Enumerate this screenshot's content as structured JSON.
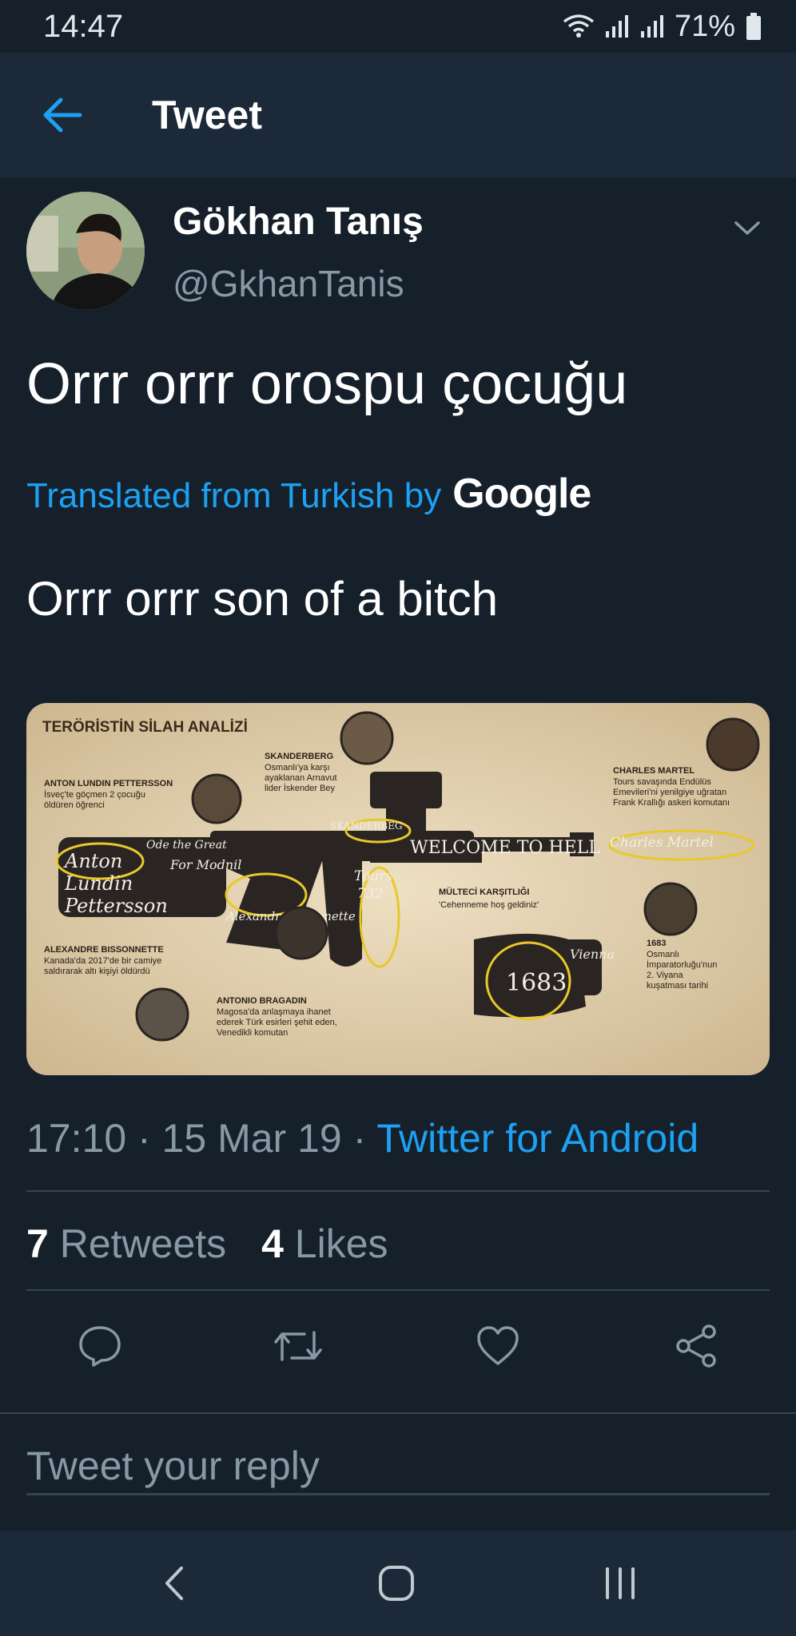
{
  "status_bar": {
    "time": "14:47",
    "battery": "71%",
    "icons": [
      "wifi-icon",
      "signal-icon",
      "signal-icon",
      "battery-icon"
    ]
  },
  "app_bar": {
    "title": "Tweet",
    "back_icon": "arrow-left-icon"
  },
  "tweet": {
    "author_name": "Gökhan Tanış",
    "author_handle": "@GkhanTanis",
    "text": "Orrr orrr orospu çocuğu",
    "translated_label": "Translated from Turkish by",
    "translator": "Google",
    "translated_text": "Orrr orrr son of a bitch",
    "timestamp": "17:10 · 15 Mar 19 · ",
    "source": "Twitter for Android"
  },
  "media": {
    "heading": "TERÖRİSTİN SİLAH ANALİZİ",
    "labels": [
      {
        "title": "ANTON LUNDIN PETTERSSON",
        "lines": [
          "İsveç'te göçmen 2 çocuğu",
          "öldüren öğrenci"
        ]
      },
      {
        "title": "SKANDERBERG",
        "lines": [
          "Osmanlı'ya karşı",
          "ayaklanan Arnavut",
          "lider İskender Bey"
        ]
      },
      {
        "title": "CHARLES MARTEL",
        "lines": [
          "Tours savaşında Endülüs",
          "Emevileri'ni yenilgiye uğratan",
          "Frank Krallığı askeri komutanı"
        ]
      },
      {
        "title": "MÜLTECİ KARŞITLIĞI",
        "lines": [
          "'Cehenneme hoş geldiniz'"
        ]
      },
      {
        "title": "ALEXANDRE BISSONNETTE",
        "lines": [
          "Kanada'da 2017'de bir camiye",
          "saldırarak altı kişiyi öldürdü"
        ]
      },
      {
        "title": "ANTONIO BRAGADIN",
        "lines": [
          "Magosa'da anlaşmaya ihanet",
          "ederek Türk esirleri şehit eden,",
          "Venedikli komutan"
        ]
      },
      {
        "title": "1683",
        "lines": [
          "Osmanlı",
          "İmparatorluğu'nun",
          "2. Viyana",
          "kuşatması tarihi"
        ]
      }
    ],
    "gun_text": {
      "anton": "Anton",
      "lundin": "Lundin",
      "pettersson": "Pettersson",
      "welcome": "WELCOME TO HELL",
      "charles": "Charles Martel",
      "tours": "Tours",
      "year732": "732",
      "year1683": "1683",
      "vienna": "Vienna",
      "skanderbeg": "SKANDERBEG",
      "ode": "Ode the Great",
      "for_modnil": "For Modnil",
      "alexandre": "Alexandre Bissonette"
    }
  },
  "stats": {
    "retweets_count": "7",
    "retweets_label": "Retweets",
    "likes_count": "4",
    "likes_label": "Likes"
  },
  "actions": [
    "reply-icon",
    "retweet-icon",
    "like-icon",
    "share-icon"
  ],
  "reply": {
    "placeholder": "Tweet your reply"
  },
  "nav": [
    "back-nav-icon",
    "home-nav-icon",
    "recents-nav-icon"
  ],
  "colors": {
    "background": "#15202b",
    "bar": "#1c2938",
    "accent": "#1da1f2",
    "secondary_text": "#8899a6",
    "divider": "#38444d"
  }
}
